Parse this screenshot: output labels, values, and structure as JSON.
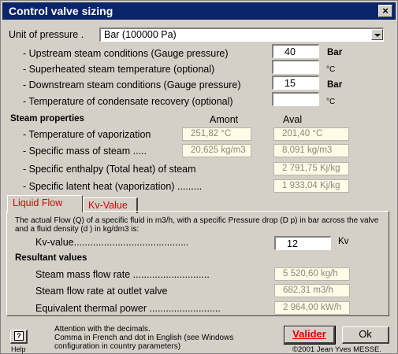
{
  "window": {
    "title": "Control valve sizing",
    "close_label": "×"
  },
  "pressure_unit": {
    "label": "Unit of pressure .",
    "selected": "Bar (100000 Pa)"
  },
  "conditions": [
    {
      "label": "- Upstream steam conditions (Gauge pressure)",
      "value": "40",
      "unit": "Bar"
    },
    {
      "label": "- Superheated steam temperature (optional)",
      "value": "",
      "unit": "°C"
    },
    {
      "label": "- Downstream steam conditions (Gauge pressure)",
      "value": "15",
      "unit": "Bar"
    },
    {
      "label": "- Temperature of condensate recovery (optional)",
      "value": "",
      "unit": "°C"
    }
  ],
  "steam_properties": {
    "heading": "Steam properties",
    "col_upstream": "Amont",
    "col_downstream": "Aval",
    "rows": [
      {
        "label": "- Temperature of vaporization",
        "amont": "251,82 °C",
        "aval": "201,40 °C"
      },
      {
        "label": "- Specific mass of steam .....",
        "amont": "20,625 kg/m3",
        "aval": "8,091 kg/m3"
      },
      {
        "label": "- Specific enthalpy (Total heat) of steam",
        "aval": "2 791,75 Kj/kg"
      },
      {
        "label": "- Specific latent heat (vaporization) .........",
        "aval": "1 933,04 Kj/kg"
      }
    ]
  },
  "tabs": [
    {
      "label": "Liquid Flow"
    },
    {
      "label": "Kv-Value"
    }
  ],
  "liquid_flow": {
    "description": "The actual Flow (Q) of a specific fluid in m3/h, with a specific Pressure drop (D p) in bar across the valve and a fluid density (d ) in kg/dm3 is:",
    "kv_label": "Kv-value..........................................",
    "kv_value": "12",
    "kv_unit": "Kv",
    "results_heading": "Resultant values",
    "results": [
      {
        "label": "Steam mass flow rate ............................",
        "value": "5 520,60 kg/h"
      },
      {
        "label": "Steam flow rate at outlet valve",
        "value": "682,31 m3/h"
      },
      {
        "label": "Equivalent thermal power ..........................",
        "value": "2 964,00 kW/h"
      }
    ]
  },
  "footer": {
    "help_label": "Help",
    "help_glyph": "?",
    "note_line1": "Attention with the decimals.",
    "note_line2": "Comma in French and dot in English (see Windows",
    "note_line3": "configuration in country parameters)",
    "validate_label": "Valider",
    "ok_label": "Ok",
    "copyright": "©2001 Jean Yves MESSE."
  }
}
